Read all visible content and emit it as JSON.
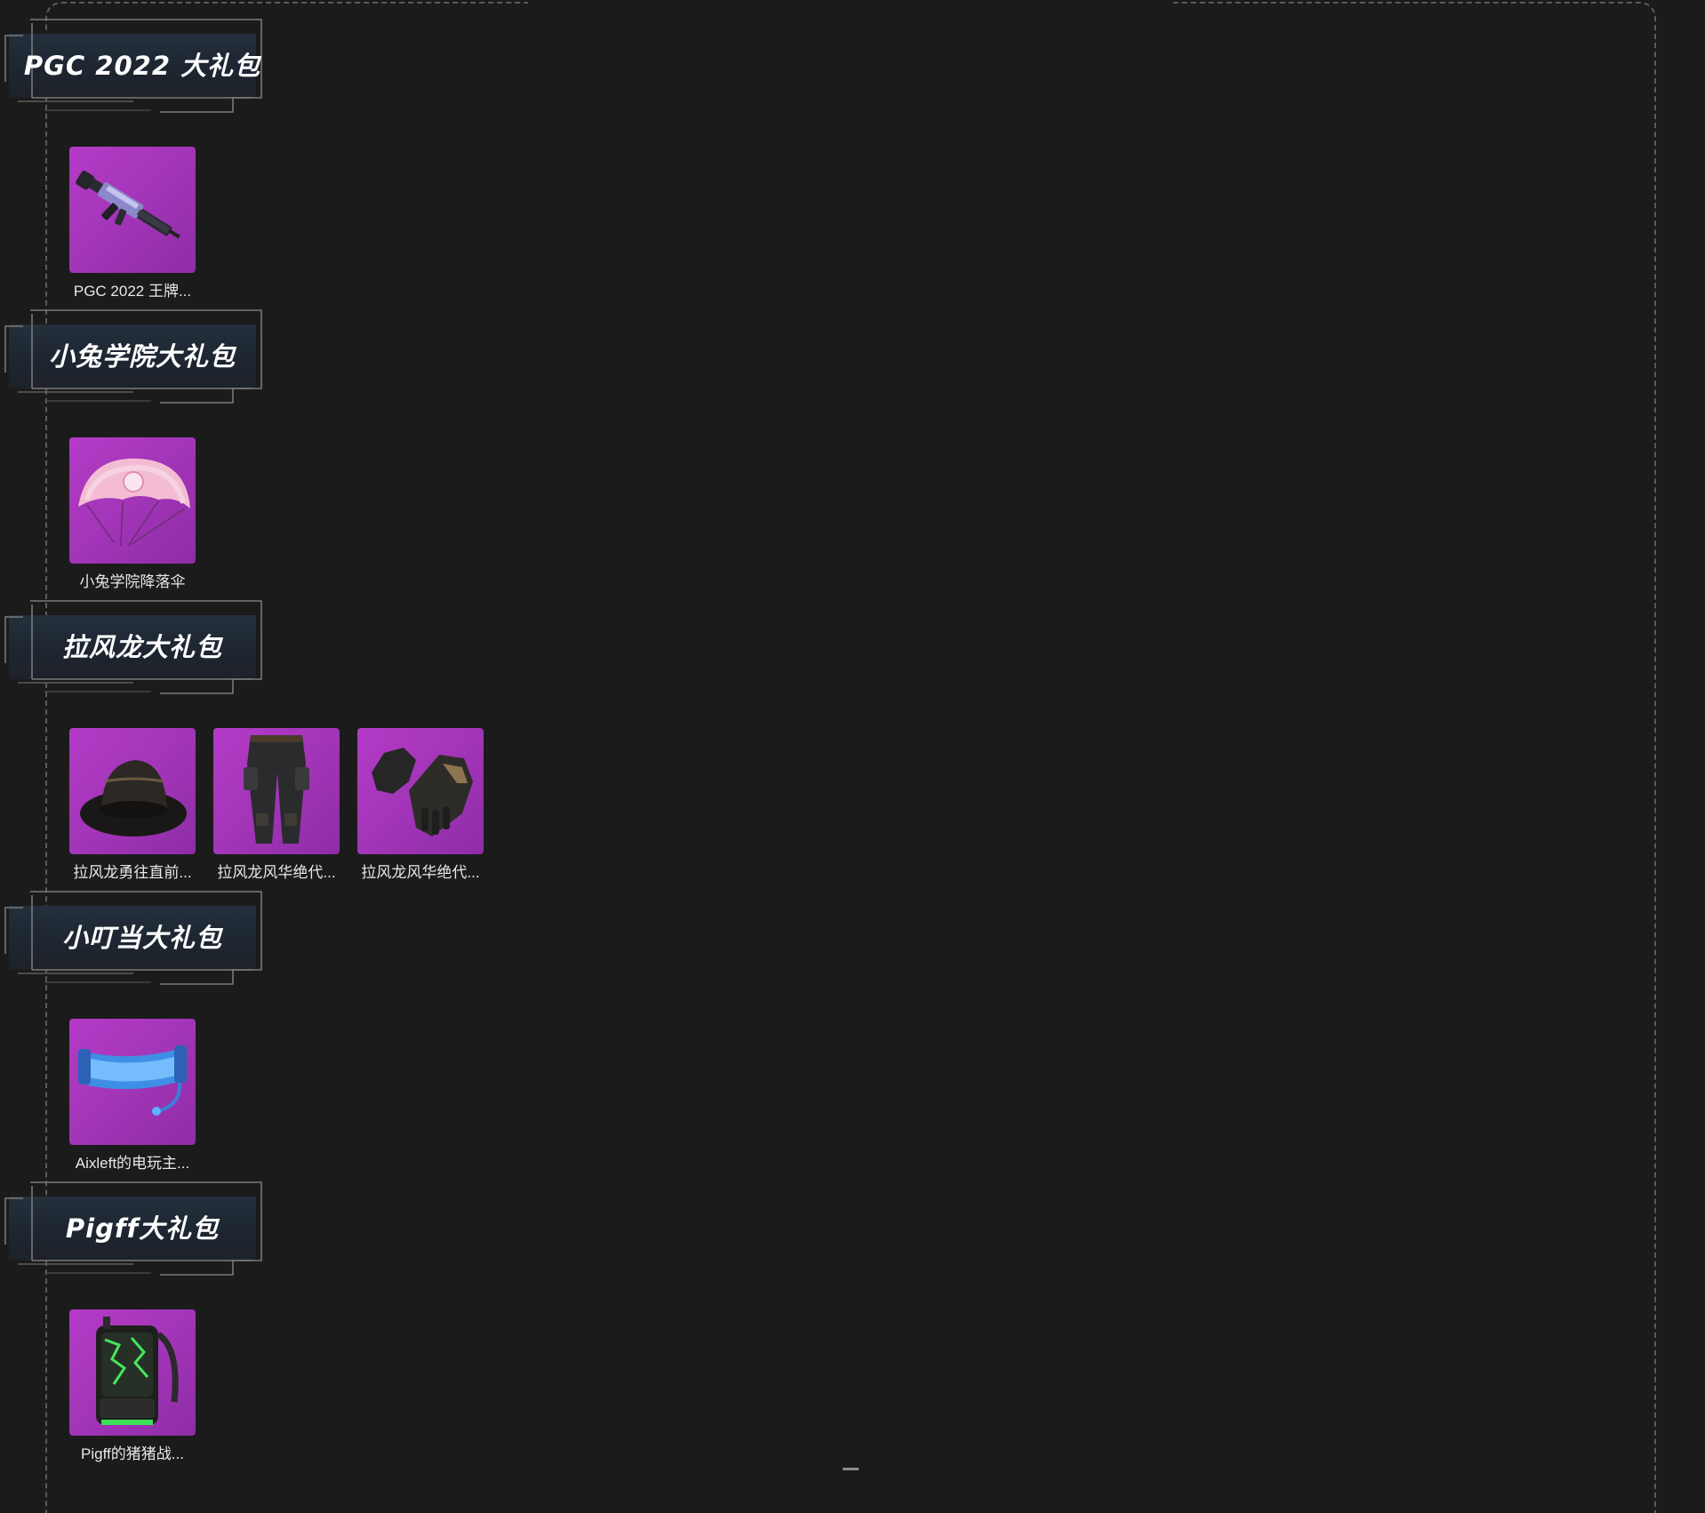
{
  "sections": [
    {
      "title": "PGC 2022 大礼包",
      "items": [
        {
          "label": "PGC 2022 王牌...",
          "icon": "rifle-icon"
        }
      ]
    },
    {
      "title": "小兔学院大礼包",
      "items": [
        {
          "label": "小兔学院降落伞",
          "icon": "parachute-icon"
        }
      ]
    },
    {
      "title": "拉风龙大礼包",
      "items": [
        {
          "label": "拉风龙勇往直前...",
          "icon": "bucket-hat-icon"
        },
        {
          "label": "拉风龙风华绝代...",
          "icon": "pants-icon"
        },
        {
          "label": "拉风龙风华绝代...",
          "icon": "gloves-icon"
        }
      ]
    },
    {
      "title": "小叮当大礼包",
      "items": [
        {
          "label": "Aixleft的电玩主...",
          "icon": "visor-headset-icon"
        }
      ]
    },
    {
      "title": "Pigff大礼包",
      "items": [
        {
          "label": "Pigff的猪猪战...",
          "icon": "backpack-icon"
        }
      ]
    }
  ],
  "colors": {
    "background": "#1b1b1b",
    "item_bg": "#a536ba",
    "header_bg": "#1f2935",
    "frame_line": "#5a5a5a"
  }
}
